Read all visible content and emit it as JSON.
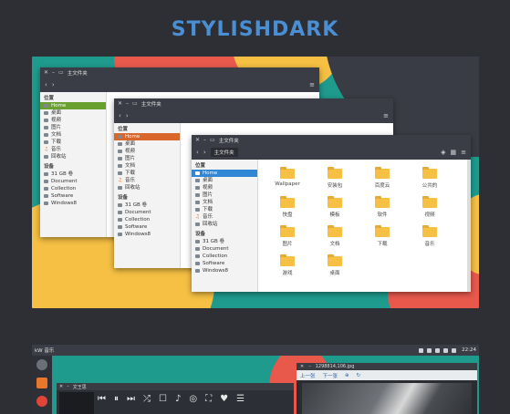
{
  "brand_title": "STYLISHDARK",
  "colors": {
    "accent": "#2f87d6",
    "teal": "#1f9b8d",
    "yellow": "#f5c043",
    "coral": "#e8594c",
    "dark": "#3a3d45"
  },
  "window_back": {
    "title": "主文件夹",
    "sidebar_section": "位置",
    "sidebar_items": [
      "Home",
      "桌面",
      "视频",
      "图片",
      "文档",
      "下载",
      "音乐",
      "回收站"
    ],
    "devices_section": "设备",
    "devices": [
      "31 GB 卷",
      "Document",
      "Collection",
      "Software",
      "Windows8"
    ]
  },
  "window_mid": {
    "title": "主文件夹",
    "sidebar_section": "位置",
    "sidebar_items": [
      "Home",
      "桌面",
      "视频",
      "图片",
      "文档",
      "下载",
      "音乐",
      "回收站"
    ],
    "devices_section": "设备",
    "devices": [
      "31 GB 卷",
      "Document",
      "Collection",
      "Software",
      "Windows8"
    ]
  },
  "window_front": {
    "title": "主文件夹",
    "path": "主文件夹",
    "sidebar_section": "位置",
    "sidebar_items": [
      "Home",
      "桌面",
      "视频",
      "图片",
      "文档",
      "下载",
      "音乐",
      "回收站"
    ],
    "devices_section": "设备",
    "devices": [
      "31 GB 卷",
      "Document",
      "Collection",
      "Software",
      "Windows8"
    ],
    "folders": [
      "Wallpaper",
      "安装包",
      "百度云",
      "公共的",
      "快盘",
      "模板",
      "软件",
      "视频",
      "图片",
      "文档",
      "下载",
      "音乐",
      "游戏",
      "桌面"
    ]
  },
  "taskbar": {
    "app": "kW 音乐",
    "clock": "22:24"
  },
  "player": {
    "song": "文王思",
    "prev": "⏮",
    "pause": "⏸",
    "next": "⏭"
  },
  "viewer": {
    "title": "1298814,106.jpg",
    "prev": "上一张",
    "next": "下一张"
  }
}
